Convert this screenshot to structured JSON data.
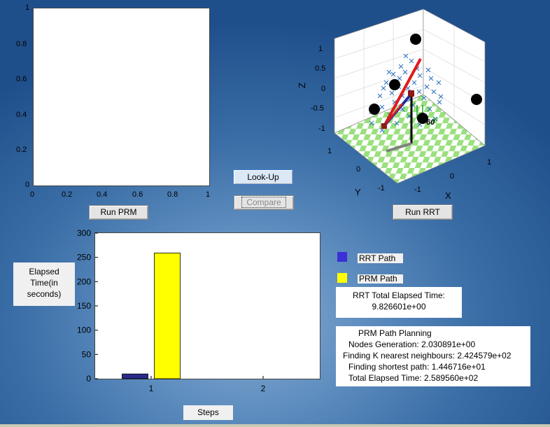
{
  "top_left_axes": {
    "x_ticks": [
      "0",
      "0.2",
      "0.4",
      "0.6",
      "0.8",
      "1"
    ],
    "y_ticks": [
      "0",
      "0.2",
      "0.4",
      "0.6",
      "0.8",
      "1"
    ]
  },
  "buttons": {
    "run_prm": "Run PRM",
    "look_up": "Look-Up",
    "compare": "Compare",
    "run_rrt": "Run RRT"
  },
  "plot3d": {
    "z_ticks": [
      "1",
      "0.5",
      "0",
      "-0.5",
      "-1"
    ],
    "y_ticks": [
      "1",
      "0",
      "-1"
    ],
    "x_ticks": [
      "-1",
      "0",
      "1"
    ],
    "xlabel": "X",
    "ylabel": "Y",
    "zlabel": "Z",
    "annotation": "60",
    "colors": {
      "floor_check": "#9be07e",
      "rrt": "#e01b1b",
      "prm": "#1f2fa0",
      "samples": "#2b6fbf",
      "obstacle": "#000000"
    }
  },
  "chart_data": {
    "type": "bar",
    "categories": [
      "1",
      "2"
    ],
    "series": [
      {
        "name": "RRT Path",
        "values": [
          9.826601,
          null
        ],
        "color": "#2a2a8c"
      },
      {
        "name": "PRM Path",
        "values": [
          258.956,
          null
        ],
        "color": "#ffff00"
      }
    ],
    "ylim": [
      0,
      300
    ],
    "y_ticks": [
      "0",
      "50",
      "100",
      "150",
      "200",
      "250",
      "300"
    ],
    "x_ticks": [
      "1",
      "2"
    ],
    "ylabel": "Elapsed Time(in seconds)",
    "xlabel": "Steps",
    "legend": "right"
  },
  "labels": {
    "ylabel_lines": [
      "Elapsed",
      "Time(in",
      "seconds)"
    ],
    "xlabel": "Steps",
    "legend_rrt": "RRT Path",
    "legend_prm": "PRM Path"
  },
  "rrt_result": {
    "title": "RRT Total Elapsed Time:",
    "value": "9.826601e+00"
  },
  "prm_result": {
    "lines": [
      "PRM Path Planning",
      "Nodes Generation: 2.030891e+00",
      "Finding K nearest neighbours: 2.424579e+02",
      "Finding shortest path: 1.446716e+01",
      "Total Elapsed Time: 2.589560e+02"
    ]
  }
}
